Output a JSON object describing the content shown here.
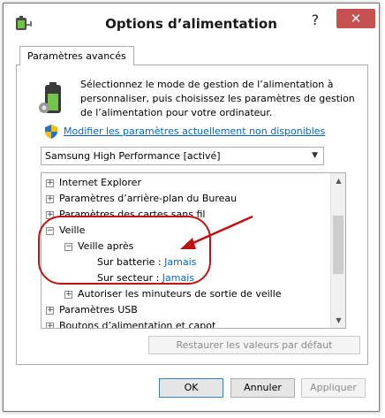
{
  "window": {
    "title": "Options d’alimentation",
    "help_glyph": "?",
    "close_glyph": "✕"
  },
  "tabs": [
    {
      "label": "Paramètres avancés"
    }
  ],
  "description": "Sélectionnez le mode de gestion de l’alimentation à personnaliser, puis choisissez les paramètres de gestion de l’alimentation pour votre ordinateur.",
  "change_link": "Modifier les paramètres actuellement non disponibles",
  "plan_select": {
    "value": "Samsung High Performance [activé]"
  },
  "tree": {
    "items": [
      {
        "label": "Internet Explorer",
        "expander": "+"
      },
      {
        "label": "Paramètres d’arrière-plan du Bureau",
        "expander": "+"
      },
      {
        "label": "Paramètres des cartes sans fil",
        "expander": "+"
      },
      {
        "label": "Veille",
        "expander": "−"
      },
      {
        "label": "Veille après",
        "expander": "−"
      },
      {
        "label": "Sur batterie :",
        "value": "Jamais"
      },
      {
        "label": "Sur secteur :",
        "value": "Jamais"
      },
      {
        "label": "Autoriser les minuteurs de sortie de veille",
        "expander": "+"
      },
      {
        "label": "Paramètres USB",
        "expander": "+"
      },
      {
        "label": "Boutons d’alimentation et capot",
        "expander": "+"
      }
    ]
  },
  "buttons": {
    "restore": "Restaurer les valeurs par défaut",
    "ok": "OK",
    "cancel": "Annuler",
    "apply": "Appliquer"
  },
  "colors": {
    "link": "#0066cc",
    "annotation": "#c01212",
    "close_button": "#c75050"
  },
  "icons": [
    "power-options-icon",
    "battery-settings-icon",
    "uac-shield-icon",
    "help-icon",
    "close-icon",
    "chevron-down-icon",
    "scroll-up-icon",
    "scroll-down-icon"
  ]
}
